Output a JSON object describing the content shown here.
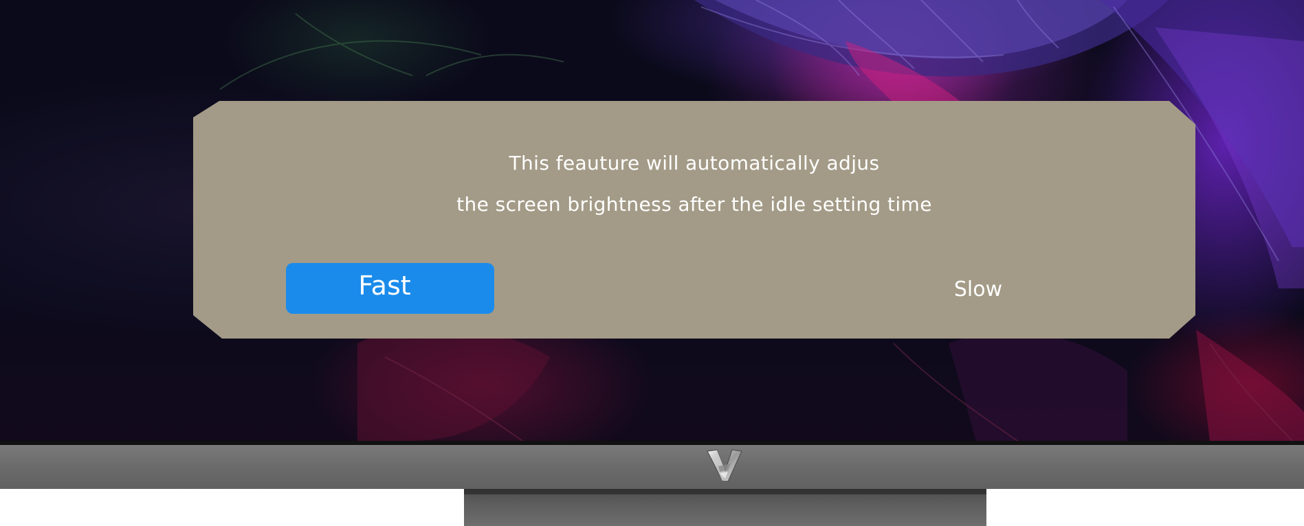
{
  "dialog": {
    "message_line1": "This feauture will automatically adjus",
    "message_line2": "the screen brightness after the idle setting time",
    "options": [
      {
        "label": "Fast",
        "selected": true
      },
      {
        "label": "Slow",
        "selected": false
      }
    ]
  },
  "colors": {
    "dialog_background": "#a39b87",
    "selected_option": "#1b8beb",
    "text": "#ffffff",
    "monitor_chin": "#6c6c6c"
  },
  "icons": {
    "monitor_logo": "brand-logo-icon"
  }
}
